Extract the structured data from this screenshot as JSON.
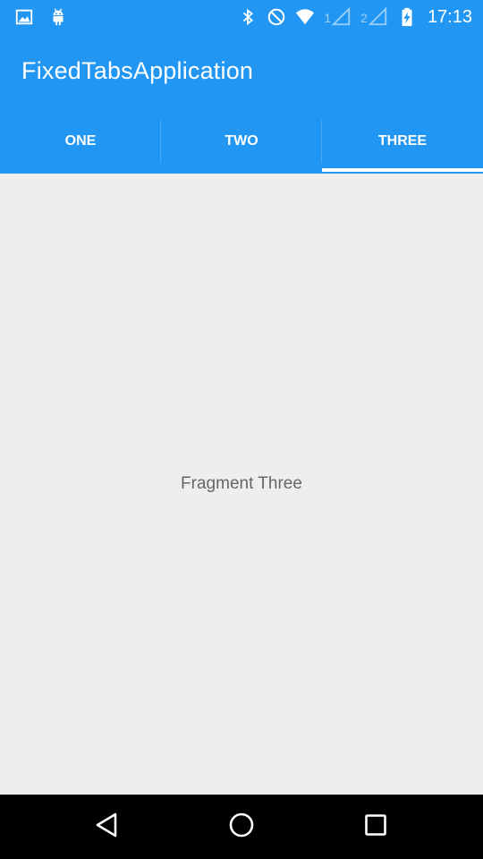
{
  "status_bar": {
    "time": "17:13",
    "sim1_label": "1",
    "sim2_label": "2",
    "icons": [
      "image-icon",
      "android-icon",
      "bluetooth-icon",
      "do-not-disturb-icon",
      "wifi-icon",
      "signal-icon",
      "signal-icon",
      "battery-charging-icon"
    ]
  },
  "app_bar": {
    "title": "FixedTabsApplication"
  },
  "tabs": [
    {
      "label": "ONE",
      "selected": false
    },
    {
      "label": "TWO",
      "selected": false
    },
    {
      "label": "THREE",
      "selected": true
    }
  ],
  "content": {
    "text": "Fragment Three"
  },
  "nav_bar": {
    "icons": [
      "back-icon",
      "home-icon",
      "recents-icon"
    ]
  },
  "colors": {
    "primary": "#2196f3",
    "background": "#eeeeee",
    "text_secondary": "#666666",
    "nav_bar": "#000000"
  }
}
